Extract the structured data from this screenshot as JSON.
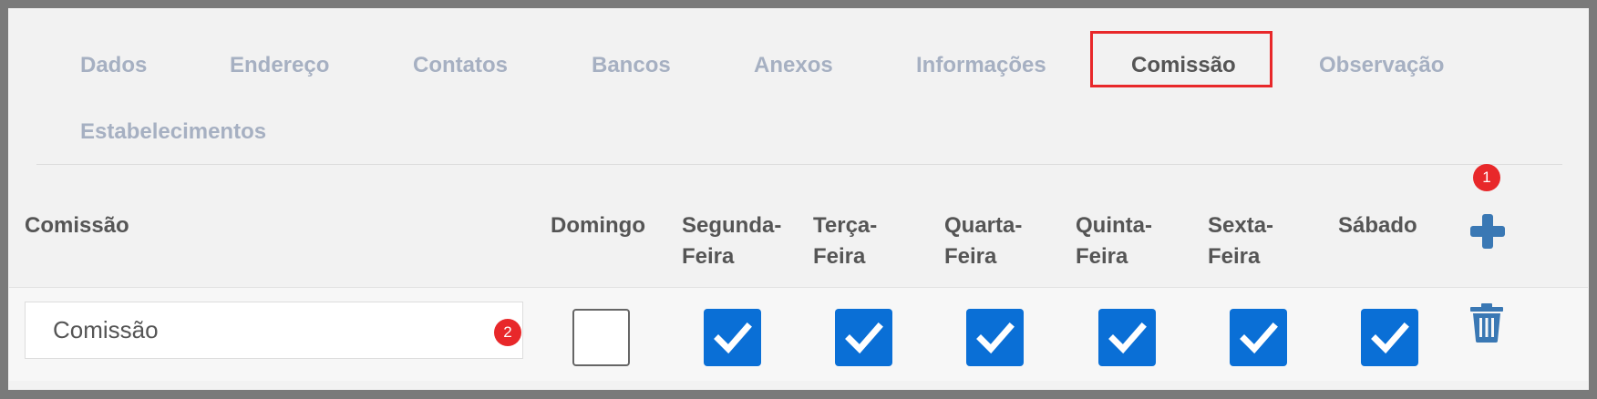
{
  "tabs": [
    {
      "label": "Dados",
      "active": false
    },
    {
      "label": "Endereço",
      "active": false
    },
    {
      "label": "Contatos",
      "active": false
    },
    {
      "label": "Bancos",
      "active": false
    },
    {
      "label": "Anexos",
      "active": false
    },
    {
      "label": "Informações",
      "active": false
    },
    {
      "label": "Comissão",
      "active": true
    },
    {
      "label": "Observação",
      "active": false
    },
    {
      "label": "Estabelecimentos",
      "active": false
    }
  ],
  "table": {
    "headers": {
      "comissao": "Comissão",
      "domingo": "Domingo",
      "segunda_1": "Segunda-",
      "segunda_2": "Feira",
      "terca_1": "Terça-",
      "terca_2": "Feira",
      "quarta_1": "Quarta-",
      "quarta_2": "Feira",
      "quinta_1": "Quinta-",
      "quinta_2": "Feira",
      "sexta_1": "Sexta-",
      "sexta_2": "Feira",
      "sabado": "Sábado"
    },
    "row": {
      "comissao_value": "Comissão",
      "days": {
        "domingo": false,
        "segunda": true,
        "terca": true,
        "quarta": true,
        "quinta": true,
        "sexta": true,
        "sabado": true
      }
    }
  },
  "annotations": {
    "badge_1": "1",
    "badge_2": "2"
  },
  "icons": {
    "add": "plus-icon",
    "delete": "trash-icon",
    "check": "checkmark-icon"
  },
  "colors": {
    "accent_blue": "#0a6fd6",
    "icon_blue": "#3a78b4",
    "highlight_red": "#e8282a",
    "tab_inactive": "#a6b0c2",
    "text_dark": "#555555"
  }
}
